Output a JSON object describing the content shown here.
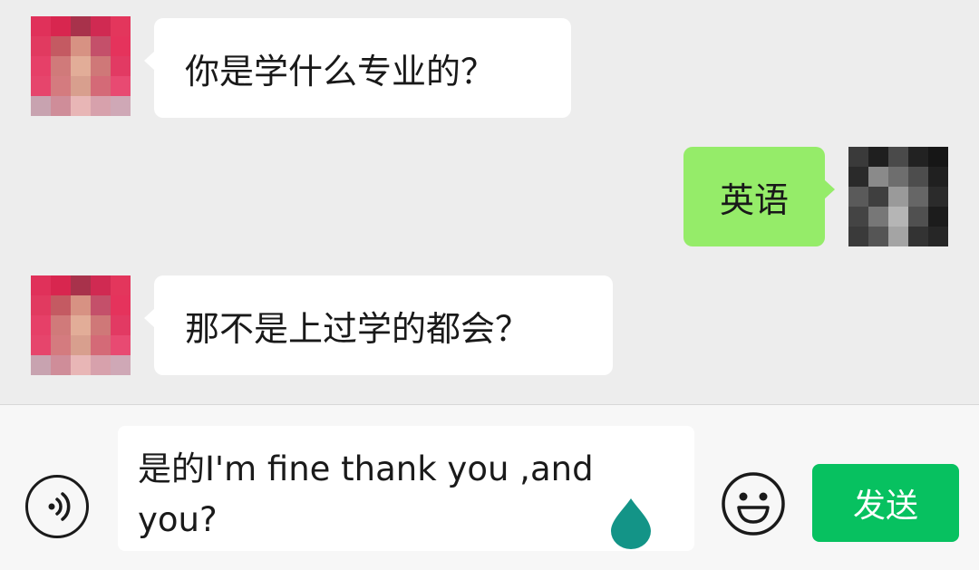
{
  "messages": [
    {
      "side": "in",
      "text": "你是学什么专业的？"
    },
    {
      "side": "out",
      "text": "英语"
    },
    {
      "side": "in",
      "text": "那不是上过学的都会？"
    }
  ],
  "input": {
    "value": "是的I'm fine thank you ,and you?"
  },
  "actions": {
    "send_label": "发送"
  },
  "icons": {
    "voice": "voice-icon",
    "emoji": "emoji-icon",
    "cursor": "text-cursor-handle-icon"
  },
  "colors": {
    "outgoing_bubble": "#95ec69",
    "send_button": "#07c160",
    "cursor_handle": "#139487"
  }
}
